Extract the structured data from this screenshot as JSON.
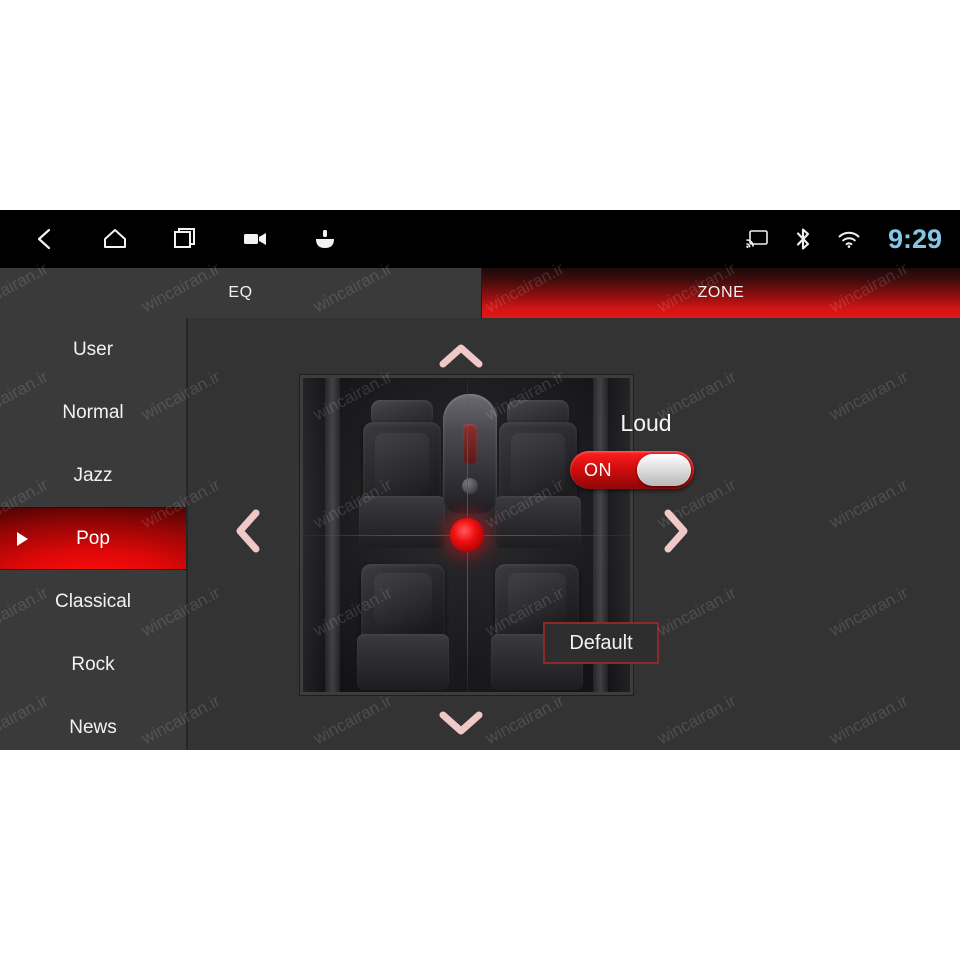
{
  "statusbar": {
    "nav_icons": [
      {
        "name": "back-icon",
        "label": "Back"
      },
      {
        "name": "home-icon",
        "label": "Home"
      },
      {
        "name": "recents-icon",
        "label": "Recent apps"
      },
      {
        "name": "video-icon",
        "label": "Video"
      },
      {
        "name": "apps-icon",
        "label": "Apps"
      }
    ],
    "sys_icons": [
      {
        "name": "cast-icon",
        "label": "Cast"
      },
      {
        "name": "bluetooth-icon",
        "label": "Bluetooth"
      },
      {
        "name": "wifi-icon",
        "label": "Wi-Fi"
      }
    ],
    "clock": "9:29",
    "clock_color": "#85c6e8"
  },
  "tabs": [
    {
      "id": "eq",
      "label": "EQ",
      "active": false
    },
    {
      "id": "zone",
      "label": "ZONE",
      "active": true
    }
  ],
  "presets": [
    {
      "label": "User",
      "selected": false
    },
    {
      "label": "Normal",
      "selected": false
    },
    {
      "label": "Jazz",
      "selected": false
    },
    {
      "label": "Pop",
      "selected": true
    },
    {
      "label": "Classical",
      "selected": false
    },
    {
      "label": "Rock",
      "selected": false
    },
    {
      "label": "News",
      "selected": false
    }
  ],
  "zone_pad": {
    "chevrons": [
      {
        "name": "zone-up-chevron",
        "direction": "up"
      },
      {
        "name": "zone-down-chevron",
        "direction": "down"
      },
      {
        "name": "zone-left-chevron",
        "direction": "left"
      },
      {
        "name": "zone-right-chevron",
        "direction": "right"
      }
    ],
    "balance_dot_color": "#f01010",
    "crosshair_color": "#e61e1e",
    "image_alt": "Car interior top view with four seats"
  },
  "controls": {
    "loud_label": "Loud",
    "loud_state": "ON",
    "loud_on": true,
    "default_label": "Default"
  },
  "theme": {
    "accent_red": "#d40d0d",
    "panel_bg": "#333333",
    "sidebar_bg": "#3a3a3a",
    "statusbar_bg": "#000000"
  },
  "watermark": {
    "text": "wincairan.ir"
  }
}
